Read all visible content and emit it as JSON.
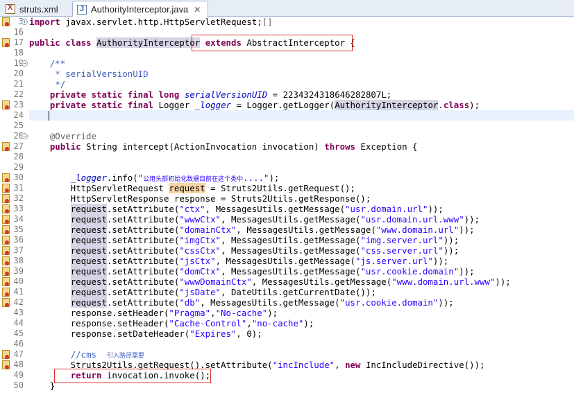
{
  "tabs": [
    {
      "label": "struts.xml",
      "icon": "xml-file-icon",
      "active": false
    },
    {
      "label": "AuthorityInterceptor.java",
      "icon": "java-file-icon",
      "active": true,
      "close": "✕"
    }
  ],
  "lines": [
    {
      "n": "3",
      "fold": "⊕",
      "marker": true,
      "html": "<span class='kw'>import</span> javax.servlet.http.HttpServletRequest;<span class='grey'>[]</span>"
    },
    {
      "n": "16",
      "html": ""
    },
    {
      "n": "17",
      "marker": true,
      "html": "<span class='kw'>public</span> <span class='kw'>class</span> <span class='hl'>AuthorityInterceptor</span> <span class='kw'>extends</span> AbstractInterceptor {"
    },
    {
      "n": "18",
      "html": ""
    },
    {
      "n": "19",
      "fold": "⊖",
      "html": "    <span class='cmt'>/**</span>"
    },
    {
      "n": "20",
      "html": "     <span class='cmt'>* serialVersionUID</span>"
    },
    {
      "n": "21",
      "html": "     <span class='cmt'>*/</span>"
    },
    {
      "n": "22",
      "html": "    <span class='kw'>private</span> <span class='kw'>static</span> <span class='kw'>final</span> <span class='kw'>long</span> <span class='field'>serialVersionUID</span> = 2234324318646282807L;"
    },
    {
      "n": "23",
      "marker": true,
      "html": "    <span class='kw'>private</span> <span class='kw'>static</span> <span class='kw'>final</span> Logger <span class='field'>_logger</span> = Logger.getLogger(<span class='hl'>AuthorityInterceptor</span>.<span class='kw'>class</span>);"
    },
    {
      "n": "24",
      "current": true,
      "html": ""
    },
    {
      "n": "25",
      "html": ""
    },
    {
      "n": "26",
      "fold": "⊖",
      "html": "    <span class='ann'>@Override</span>"
    },
    {
      "n": "27",
      "marker": true,
      "html": "    <span class='kw'>public</span> String intercept(ActionInvocation invocation) <span class='kw'>throws</span> Exception {"
    },
    {
      "n": "28",
      "html": ""
    },
    {
      "n": "29",
      "html": ""
    },
    {
      "n": "30",
      "marker": true,
      "html": "        <span class='field'>_logger</span>.info(<span class='str'>\"<span class='cn-small'>公用头部初始化数据目前在这个类中</span>....\"</span>);"
    },
    {
      "n": "31",
      "marker": true,
      "html": "        HttpServletRequest <span class='hl-orange'>request</span> = Struts2Utils.getRequest();"
    },
    {
      "n": "32",
      "marker": true,
      "html": "        HttpServletResponse response = Struts2Utils.getResponse();"
    },
    {
      "n": "33",
      "marker": true,
      "html": "        <span class='hl'>request</span>.setAttribute(<span class='str'>\"ctx\"</span>, MessagesUtils.getMessage(<span class='str'>\"usr.domain.url\"</span>));"
    },
    {
      "n": "34",
      "marker": true,
      "html": "        <span class='hl'>request</span>.setAttribute(<span class='str'>\"wwwCtx\"</span>, MessagesUtils.getMessage(<span class='str'>\"usr.domain.url.www\"</span>));"
    },
    {
      "n": "35",
      "marker": true,
      "html": "        <span class='hl'>request</span>.setAttribute(<span class='str'>\"domainCtx\"</span>, MessagesUtils.getMessage(<span class='str'>\"www.domain.url\"</span>));"
    },
    {
      "n": "36",
      "marker": true,
      "html": "        <span class='hl'>request</span>.setAttribute(<span class='str'>\"imgCtx\"</span>, MessagesUtils.getMessage(<span class='str'>\"img.server.url\"</span>));"
    },
    {
      "n": "37",
      "marker": true,
      "html": "        <span class='hl'>request</span>.setAttribute(<span class='str'>\"cssCtx\"</span>, MessagesUtils.getMessage(<span class='str'>\"css.server.url\"</span>));"
    },
    {
      "n": "38",
      "marker": true,
      "html": "        <span class='hl'>request</span>.setAttribute(<span class='str'>\"jsCtx\"</span>, MessagesUtils.getMessage(<span class='str'>\"js.server.url\"</span>));"
    },
    {
      "n": "39",
      "marker": true,
      "html": "        <span class='hl'>request</span>.setAttribute(<span class='str'>\"domCtx\"</span>, MessagesUtils.getMessage(<span class='str'>\"usr.cookie.domain\"</span>));"
    },
    {
      "n": "40",
      "marker": true,
      "html": "        <span class='hl'>request</span>.setAttribute(<span class='str'>\"wwwDomainCtx\"</span>, MessagesUtils.getMessage(<span class='str'>\"www.domain.url.www\"</span>));"
    },
    {
      "n": "41",
      "marker": true,
      "html": "        <span class='hl'>request</span>.setAttribute(<span class='str'>\"jsDate\"</span>, DateUtils.getCurrentDate());"
    },
    {
      "n": "42",
      "marker": true,
      "html": "        <span class='hl'>request</span>.setAttribute(<span class='str'>\"db\"</span>, MessagesUtils.getMessage(<span class='str'>\"usr.cookie.domain\"</span>));"
    },
    {
      "n": "43",
      "html": "        response.setHeader(<span class='str'>\"Pragma\"</span>,<span class='str'>\"No-cache\"</span>);"
    },
    {
      "n": "44",
      "html": "        response.setHeader(<span class='str'>\"Cache-Control\"</span>,<span class='str'>\"no-cache\"</span>);"
    },
    {
      "n": "45",
      "html": "        response.setDateHeader(<span class='str'>\"Expires\"</span>, 0);"
    },
    {
      "n": "46",
      "html": ""
    },
    {
      "n": "47",
      "marker": true,
      "html": "        <span class='cmt'>//cms  <span class='cn-small'>引入路径需要</span></span>"
    },
    {
      "n": "48",
      "marker": true,
      "html": "        Struts2Utils.getRequest().setAttribute(<span class='str'>\"incInclude\"</span>, <span class='kw'>new</span> IncIncludeDirective());"
    },
    {
      "n": "49",
      "html": "        <span class='kw'>return</span> invocation.invoke();"
    },
    {
      "n": "50",
      "html": "    }"
    }
  ]
}
